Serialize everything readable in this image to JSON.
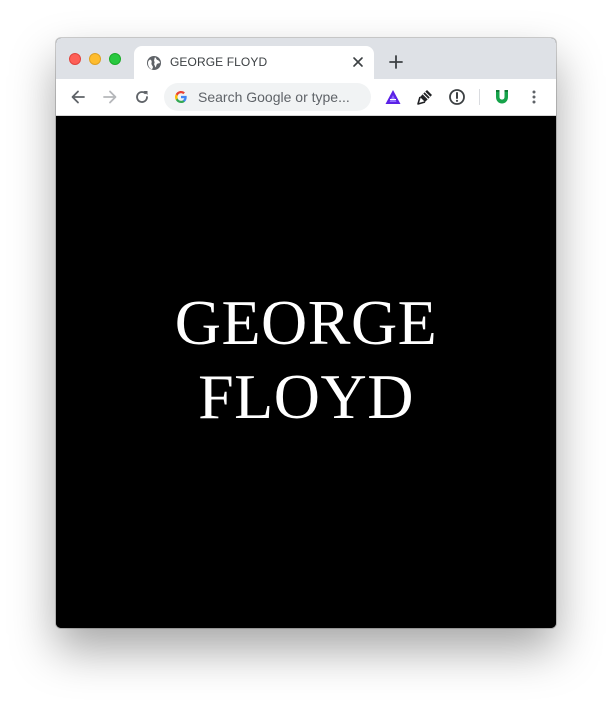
{
  "browser": {
    "tab": {
      "title": "GEORGE FLOYD",
      "favicon": "globe-icon"
    },
    "omnibox": {
      "placeholder": "Search Google or type..."
    },
    "toolbar": {
      "back": "back-arrow-icon",
      "forward": "forward-arrow-icon",
      "reload": "reload-icon",
      "menu": "kebab-menu-icon"
    },
    "extensions": [
      "triangle-extension-icon",
      "brush-extension-icon",
      "info-extension-icon",
      "shield-extension-icon"
    ]
  },
  "page": {
    "headline_line1": "GEORGE",
    "headline_line2": "FLOYD"
  },
  "colors": {
    "page_background": "#000000",
    "headline": "#ffffff",
    "tabstrip": "#dee1e6"
  }
}
